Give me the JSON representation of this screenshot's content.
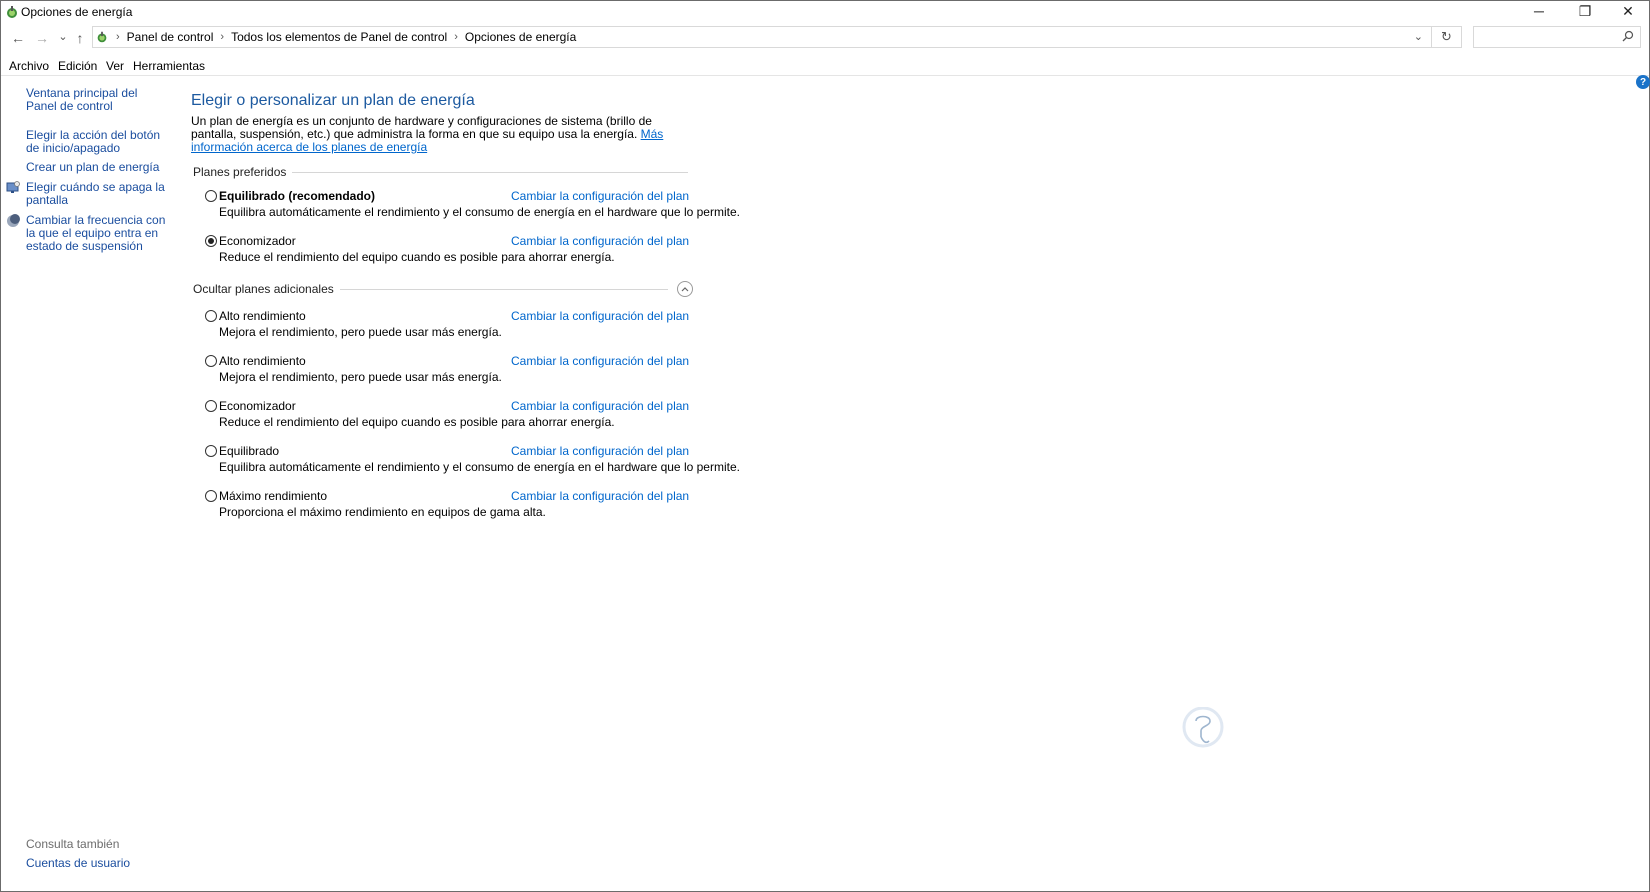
{
  "window": {
    "title": "Opciones de energía",
    "minimize_glyph": "─",
    "restore_glyph": "❐",
    "close_glyph": "✕"
  },
  "nav": {
    "back_glyph": "←",
    "forward_glyph": "→",
    "recent_glyph": "⌄",
    "up_glyph": "↑",
    "refresh_glyph": "↻",
    "dropdown_glyph": "⌄",
    "breadcrumb": [
      "Panel de control",
      "Todos los elementos de Panel de control",
      "Opciones de energía"
    ],
    "search_placeholder": ""
  },
  "menu": [
    "Archivo",
    "Edición",
    "Ver",
    "Herramientas"
  ],
  "sidebar": {
    "links": [
      {
        "label": "Ventana principal del Panel de control",
        "icon": ""
      },
      {
        "label": "Elegir la acción del botón de inicio/apagado",
        "icon": ""
      },
      {
        "label": "Crear un plan de energía",
        "icon": ""
      },
      {
        "label": "Elegir cuándo se apaga la pantalla",
        "icon": "monitor-icon"
      },
      {
        "label": "Cambiar la frecuencia con la que el equipo entra en estado de suspensión",
        "icon": "moon-icon"
      }
    ],
    "see_also_title": "Consulta también",
    "see_also_links": [
      "Cuentas de usuario"
    ]
  },
  "main": {
    "heading": "Elegir o personalizar un plan de energía",
    "intro_text": "Un plan de energía es un conjunto de hardware y configuraciones de sistema (brillo de pantalla, suspensión, etc.) que administra la forma en que su equipo usa la energía. ",
    "intro_link": "Más información acerca de los planes de energía",
    "preferred_title": "Planes preferidos",
    "additional_title": "Ocultar planes adicionales",
    "change_link_label": "Cambiar la configuración del plan",
    "preferred_plans": [
      {
        "name": "Equilibrado (recomendado)",
        "description": "Equilibra automáticamente el rendimiento y el consumo de energía en el hardware que lo permite.",
        "selected": false,
        "bold": true
      },
      {
        "name": "Economizador",
        "description": "Reduce el rendimiento del equipo cuando es posible para ahorrar energía.",
        "selected": true,
        "bold": false
      }
    ],
    "additional_plans": [
      {
        "name": "Alto rendimiento",
        "description": "Mejora el rendimiento, pero puede usar más energía.",
        "selected": false
      },
      {
        "name": "Alto rendimiento",
        "description": "Mejora el rendimiento, pero puede usar más energía.",
        "selected": false
      },
      {
        "name": "Economizador",
        "description": "Reduce el rendimiento del equipo cuando es posible para ahorrar energía.",
        "selected": false
      },
      {
        "name": "Equilibrado",
        "description": "Equilibra automáticamente el rendimiento y el consumo de energía en el hardware que lo permite.",
        "selected": false
      },
      {
        "name": "Máximo rendimiento",
        "description": "Proporciona el máximo rendimiento en equipos de gama alta.",
        "selected": false
      }
    ]
  },
  "help_glyph": "?",
  "colors": {
    "link": "#0066cc",
    "heading": "#1d5aa0",
    "sidebar_link": "#1a4d9e"
  }
}
